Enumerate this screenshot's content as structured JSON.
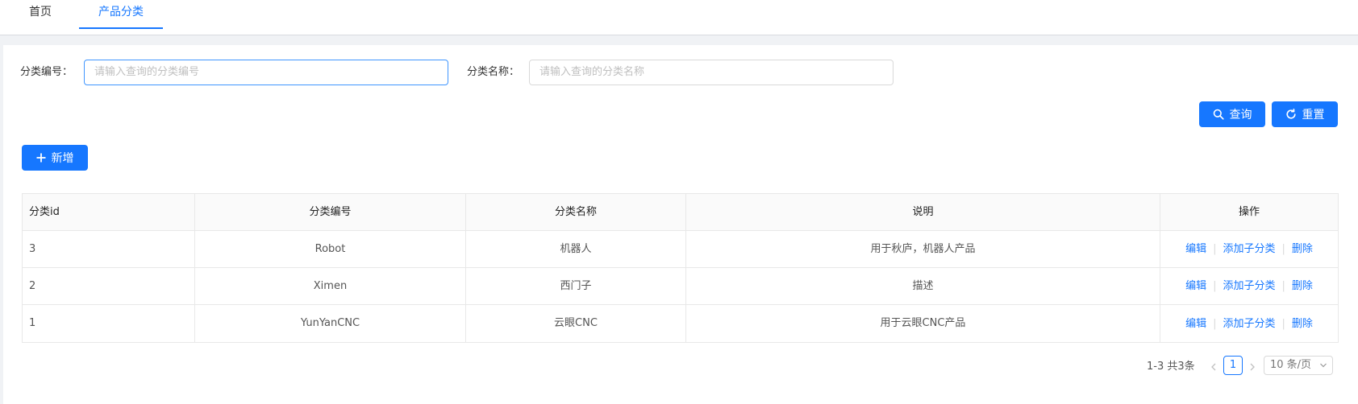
{
  "tabs": {
    "home": "首页",
    "active": "产品分类"
  },
  "search": {
    "code_label": "分类编号：",
    "code_placeholder": "请输入查询的分类编号",
    "name_label": "分类名称：",
    "name_placeholder": "请输入查询的分类名称",
    "query_button": "查询",
    "reset_button": "重置"
  },
  "toolbar": {
    "add_button": "新增"
  },
  "table": {
    "headers": [
      "分类id",
      "分类编号",
      "分类名称",
      "说明",
      "操作"
    ],
    "rows": [
      {
        "id": "3",
        "code": "Robot",
        "name": "机器人",
        "desc": "用于秋庐，机器人产品"
      },
      {
        "id": "2",
        "code": "Ximen",
        "name": "西门子",
        "desc": "描述"
      },
      {
        "id": "1",
        "code": "YunYanCNC",
        "name": "云眼CNC",
        "desc": "用于云眼CNC产品"
      }
    ],
    "actions": {
      "edit": "编辑",
      "add_child": "添加子分类",
      "delete": "删除"
    }
  },
  "pagination": {
    "total": "1-3 共3条",
    "current_page": "1",
    "page_size": "10 条/页"
  },
  "colors": {
    "primary": "#1677ff",
    "border": "#d9d9d9",
    "background": "#f0f2f5"
  }
}
